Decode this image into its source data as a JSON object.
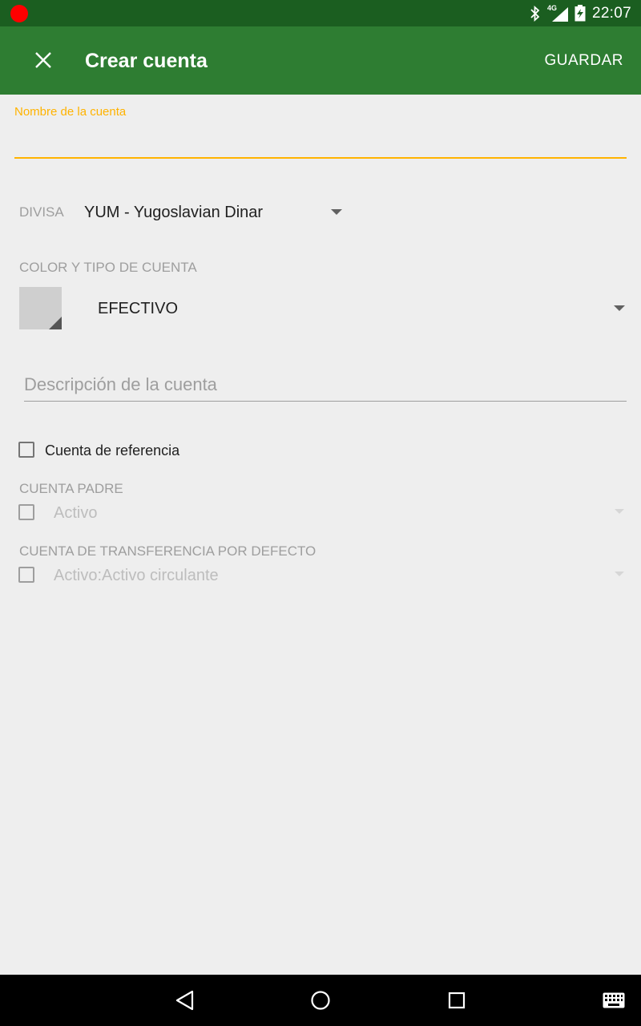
{
  "status_bar": {
    "time": "22:07",
    "network_label": "4G",
    "icons": [
      "record-dot-icon",
      "bluetooth-icon",
      "signal-icon",
      "battery-charging-icon"
    ]
  },
  "toolbar": {
    "title": "Crear cuenta",
    "save_label": "GUARDAR",
    "close_icon": "close-icon",
    "background": "#2e7d32"
  },
  "form": {
    "account_name": {
      "label": "Nombre de la cuenta",
      "value": "",
      "accent": "#ffb300"
    },
    "currency": {
      "label": "DIVISA",
      "value": "YUM - Yugoslavian Dinar"
    },
    "color_type": {
      "label": "COLOR Y TIPO DE CUENTA",
      "type_value": "EFECTIVO",
      "swatch_color": "#cfcfcf"
    },
    "description": {
      "placeholder": "Descripción de la cuenta",
      "value": ""
    },
    "reference_account": {
      "label": "Cuenta de referencia",
      "checked": false
    },
    "parent_account": {
      "label": "CUENTA PADRE",
      "value": "Activo",
      "checked": false,
      "enabled": false
    },
    "default_transfer": {
      "label": "CUENTA DE TRANSFERENCIA POR DEFECTO",
      "value": "Activo:Activo circulante",
      "checked": false,
      "enabled": false
    }
  },
  "nav_bar": {
    "icons": [
      "back-icon",
      "home-icon",
      "recents-icon",
      "keyboard-icon"
    ]
  }
}
